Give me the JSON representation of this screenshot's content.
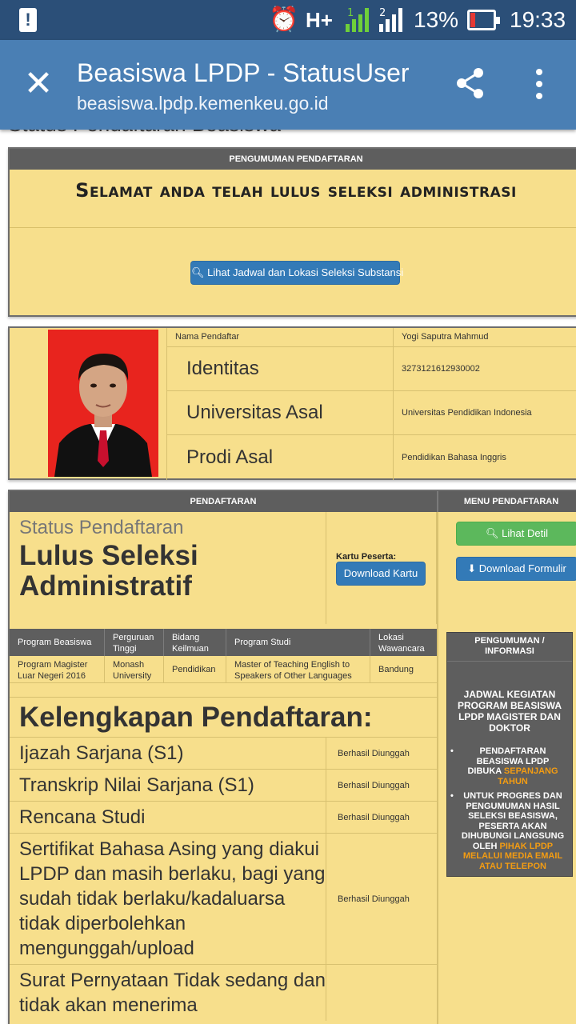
{
  "status_bar": {
    "network": "H+",
    "sim1": "1",
    "sim2": "2",
    "battery": "13%",
    "battery_level": 0.13,
    "time": "19:33"
  },
  "appbar": {
    "title": "Beasiswa LPDP - StatusUser",
    "url": "beasiswa.lpdp.kemenkeu.go.id"
  },
  "page": {
    "cut_heading": "Status Pendaftaran Beasiswa"
  },
  "announcement": {
    "header": "PENGUMUMAN PENDAFTARAN",
    "title": "Selamat anda telah lulus seleksi administrasi",
    "button": "Lihat Jadwal dan Lokasi Seleksi Substansi"
  },
  "profile": {
    "rows": [
      {
        "label": "Nama Pendaftar",
        "value": "Yogi Saputra Mahmud"
      },
      {
        "label": "Identitas",
        "value": "3273121612930002"
      },
      {
        "label": "Universitas Asal",
        "value": "Universitas Pendidikan Indonesia"
      },
      {
        "label": "Prodi Asal",
        "value": "Pendidikan Bahasa Inggris"
      }
    ]
  },
  "registration": {
    "header": "PENDAFTARAN",
    "status_label": "Status Pendaftaran",
    "status_value": "Lulus Seleksi Administratif",
    "kartu_label": "Kartu Peserta:",
    "kartu_button": "Download Kartu",
    "table_headers": [
      "Program Beasiswa",
      "Perguruan Tinggi",
      "Bidang Keilmuan",
      "Program Studi",
      "Lokasi Wawancara"
    ],
    "table_row": [
      "Program Magister Luar Negeri 2016",
      "Monash University",
      "Pendidikan",
      "Master of Teaching English to Speakers of Other Languages",
      "Bandung"
    ],
    "kelengkapan_title": "Kelengkapan Pendaftaran:",
    "documents": [
      {
        "name": "Ijazah Sarjana (S1)",
        "status": "Berhasil Diunggah"
      },
      {
        "name": "Transkrip Nilai Sarjana (S1)",
        "status": "Berhasil Diunggah"
      },
      {
        "name": "Rencana Studi",
        "status": "Berhasil Diunggah"
      },
      {
        "name": "Sertifikat Bahasa Asing yang diakui LPDP dan masih berlaku, bagi yang sudah tidak berlaku/kadaluarsa tidak diperbolehkan mengunggah/upload",
        "status": "Berhasil Diunggah"
      },
      {
        "name": "Surat Pernyataan Tidak sedang dan tidak akan menerima",
        "status": ""
      }
    ]
  },
  "menu": {
    "header": "MENU PENDAFTARAN",
    "detail_button": "Lihat Detil",
    "form_button": "Download Formulir",
    "info_header": "PENGUMUMAN / INFORMASI",
    "info_title": "JADWAL KEGIATAN PROGRAM BEASISWA LPDP MAGISTER DAN DOKTOR",
    "info_item1_text": "PENDAFTARAN BEASISWA LPDP DIBUKA",
    "info_item1_highlight": "SEPANJANG TAHUN",
    "info_item2_text": "UNTUK PROGRES DAN PENGUMUMAN HASIL SELEKSI BEASISWA, PESERTA AKAN DIHUBUNGI LANGSUNG OLEH",
    "info_item2_highlight": "PIHAK LPDP MELALUI MEDIA EMAIL ATAU TELEPON"
  },
  "colors": {
    "appbar": "#4a7fb4",
    "panel_bg": "#f7df8c",
    "header_bg": "#5e5e5e",
    "primary_button": "#337ab7",
    "success_button": "#5cb85c",
    "highlight": "#f39c12"
  }
}
